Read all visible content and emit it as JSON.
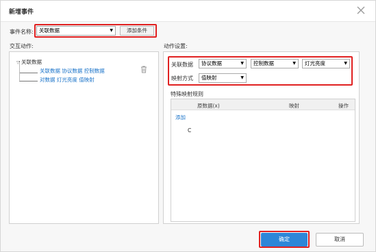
{
  "dialog": {
    "title": "新增事件"
  },
  "event": {
    "name_label": "事件名称:",
    "name_value": "关联数据",
    "add_condition_label": "添加条件"
  },
  "interaction": {
    "label": "交互动作:",
    "tree": {
      "root": "关联数据",
      "items": [
        "关联数据 协议数据 控制数据",
        "对数据 灯光亮度 值映射"
      ]
    }
  },
  "settings": {
    "label": "动作设置:",
    "assoc_label": "关联数据",
    "assoc_selects": [
      "协议数据",
      "控制数据",
      "灯光亮度"
    ],
    "map_label": "映射方式",
    "map_value": "值映射",
    "special_rules_label": "特殊映射规则",
    "table": {
      "headers": [
        "原数据(x)",
        "映射",
        "操作"
      ],
      "add_link": "添加",
      "cell": "C"
    }
  },
  "footer": {
    "ok_label": "确定",
    "cancel_label": "取消"
  },
  "colors": {
    "highlight": "#e02020",
    "primary": "#2d86d8",
    "link": "#1a73c9"
  },
  "icons": {
    "close": "close-icon",
    "delete": "trash-icon",
    "dropdown": "caret-down-icon"
  }
}
